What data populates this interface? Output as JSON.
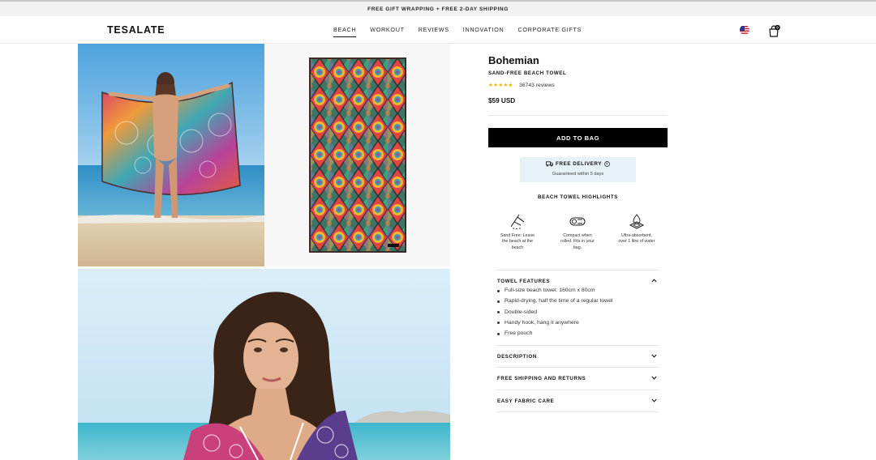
{
  "announcement": "FREE GIFT WRAPPING + FREE 2-DAY SHIPPING",
  "brand": "TESALATE",
  "nav": [
    "BEACH",
    "WORKOUT",
    "REVIEWS",
    "INNOVATION",
    "CORPORATE GIFTS"
  ],
  "nav_active": "BEACH",
  "cart": {
    "count": "0"
  },
  "product": {
    "title": "Bohemian",
    "subtitle": "SAND-FREE BEACH TOWEL",
    "stars": "★★★★★",
    "reviews": "36743 reviews",
    "price": "$59 USD",
    "add_to_bag": "ADD TO BAG"
  },
  "delivery": {
    "title": "FREE DELIVERY",
    "subtitle": "Guaranteed within 5 days"
  },
  "highlights": {
    "title": "BEACH TOWEL HIGHLIGHTS",
    "items": [
      {
        "icon": "sand-free-icon",
        "caption_lines": [
          "Sand Free: Leave",
          "the beach at the",
          "beach"
        ]
      },
      {
        "icon": "compact-roll-icon",
        "caption_lines": [
          "Compact when",
          "rolled. Fits in your",
          "bag."
        ]
      },
      {
        "icon": "absorbent-icon",
        "caption_lines": [
          "Ultra-absorbent,",
          "over 1 litre of water"
        ]
      }
    ]
  },
  "accordion": {
    "features": {
      "label": "TOWEL FEATURES",
      "items": [
        "Full-size beach towel: 160cm x 80cm",
        "Rapid-drying, half the time of a regular towel",
        "Double-sided",
        "Handy hook, hang it anywhere",
        "Free pouch"
      ]
    },
    "description": "DESCRIPTION",
    "shipping": "FREE SHIPPING AND RETURNS",
    "care": "EASY FABRIC CARE"
  },
  "colors": {
    "button_bg": "#000000",
    "delivery_bg": "#e6f2f7",
    "star": "#f3b300",
    "topbar_bg": "#f2f2f2"
  }
}
